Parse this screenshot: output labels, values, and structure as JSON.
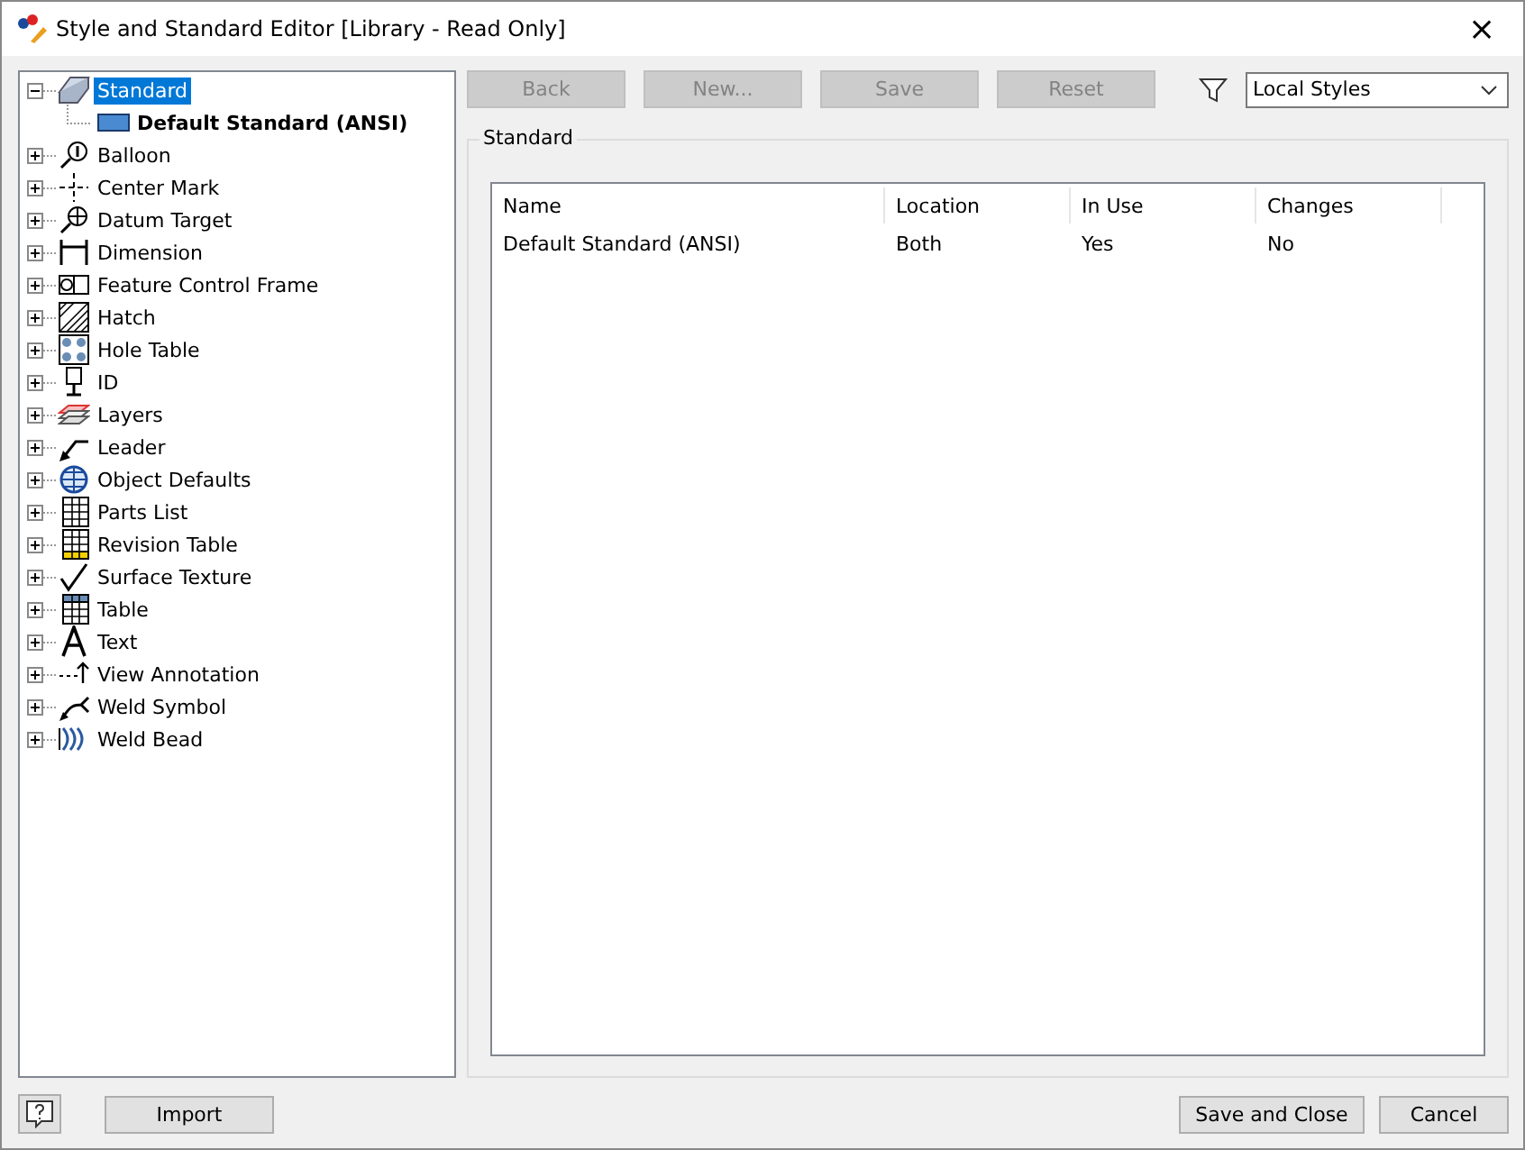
{
  "window": {
    "title": "Style and Standard Editor [Library - Read Only]",
    "close": "×"
  },
  "tree": [
    {
      "label": "Standard",
      "expanded": true,
      "selected": true,
      "children": [
        {
          "label": "Default Standard (ANSI)",
          "selected": false
        }
      ]
    },
    {
      "label": "Balloon",
      "expanded": false,
      "selected": false
    },
    {
      "label": "Center Mark",
      "expanded": false,
      "selected": false
    },
    {
      "label": "Datum Target",
      "expanded": false,
      "selected": false
    },
    {
      "label": "Dimension",
      "expanded": false,
      "selected": false
    },
    {
      "label": "Feature Control Frame",
      "expanded": false,
      "selected": false
    },
    {
      "label": "Hatch",
      "expanded": false,
      "selected": false
    },
    {
      "label": "Hole Table",
      "expanded": false,
      "selected": false
    },
    {
      "label": "ID",
      "expanded": false,
      "selected": false
    },
    {
      "label": "Layers",
      "expanded": false,
      "selected": false
    },
    {
      "label": "Leader",
      "expanded": false,
      "selected": false
    },
    {
      "label": "Object Defaults",
      "expanded": false,
      "selected": false
    },
    {
      "label": "Parts List",
      "expanded": false,
      "selected": false
    },
    {
      "label": "Revision Table",
      "expanded": false,
      "selected": false
    },
    {
      "label": "Surface Texture",
      "expanded": false,
      "selected": false
    },
    {
      "label": "Table",
      "expanded": false,
      "selected": false
    },
    {
      "label": "Text",
      "expanded": false,
      "selected": false
    },
    {
      "label": "View Annotation",
      "expanded": false,
      "selected": false
    },
    {
      "label": "Weld Symbol",
      "expanded": false,
      "selected": false
    },
    {
      "label": "Weld Bead",
      "expanded": false,
      "selected": false
    }
  ],
  "toolbar": [
    {
      "label": "Back",
      "disabled": true
    },
    {
      "label": "New...",
      "disabled": true
    },
    {
      "label": "Save",
      "disabled": true
    },
    {
      "label": "Reset",
      "disabled": true
    }
  ],
  "filter": {
    "value": "Local Styles"
  },
  "group": {
    "title": "Standard"
  },
  "table": {
    "columns": [
      "Name",
      "Location",
      "In Use",
      "Changes"
    ],
    "rows": [
      [
        "Default Standard (ANSI)",
        "Both",
        "Yes",
        "No"
      ]
    ]
  },
  "footer": {
    "import": "Import",
    "buttons": [
      "Save and Close",
      "Cancel"
    ]
  }
}
